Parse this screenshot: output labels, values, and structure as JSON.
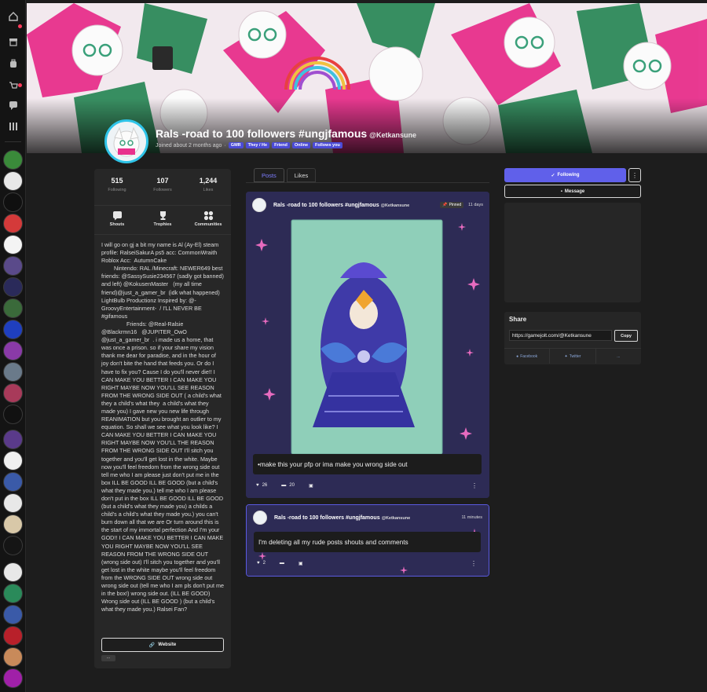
{
  "rail": {
    "nav_icons": [
      "home-icon",
      "store-icon",
      "backpack-icon",
      "cart-icon",
      "chat-icon",
      "library-icon"
    ]
  },
  "profile": {
    "display_name": "Rals -road to 100 followers #ungjfamous",
    "handle": "@Ketkansune",
    "joined": "Joined about 2 months ago",
    "tags": [
      "GMR",
      "They / He",
      "Friend",
      "Online",
      "Follows you"
    ]
  },
  "stats": [
    {
      "value": "515",
      "label": "Following"
    },
    {
      "value": "107",
      "label": "Followers"
    },
    {
      "value": "1,244",
      "label": "Likes"
    }
  ],
  "actions": [
    {
      "label": "Shouts",
      "icon": "chat-bubble-icon"
    },
    {
      "label": "Trophies",
      "icon": "trophy-icon"
    },
    {
      "label": "Communities",
      "icon": "grid-icon"
    }
  ],
  "bio": "I will go on gj a bit my name is Al (Ay-El) steam profile: RalseiSakurA ps5 acc: CommonWraith Roblox Acc:  AutumnCake\n        Nintendo: RAL /Minecraft: NEWER649 best friends: @SassySusie234567 (sadly got banned) and left) @KokusenMaster   (my all time friend)@just_a_gamer_br  (idk what happened) LightBulb Productionz Inspired by: @-GroovyEntertainment-  / I'LL NEVER BE #gifamous \n                Friends: @Real-Ralsie \n@Blackrmn16   @JUPITER_OwO \n@just_a_gamer_br  . i made us a home, that was once a prison. so if your share my vision thank me dear for paradise, and in the hour of joy don't bite the hand that feeds you. Or do I have to fix you? Cause I do you'll never die!! I CAN MAKE YOU BETTER I CAN MAKE YOU RIGHT MAYBE NOW YOU'LL SEE REASON FROM THE WRONG SIDE OUT ( a child's what they a child's what they  a child's what they made you) I gave new you new life through REANIMATION but you brought an outlier to my equation. So shall we see what you look like? I CAN MAKE YOU BETTER I CAN MAKE YOU RIGHT MAYBE NOW YOU'LL THE REASON FROM THE WRONG SIDE OUT I'll sitch you together and you'll get lost in the white. Maybe now you'll feel freedom from the wrong side out tell me who I am please just don't put me in the box ILL BE GOOD ILL BE GOOD (but a child's what they made you.) tell me who I am please don't put in the box ILL BE GOOD ILL BE GOOD (but a child's what they made you) a childs a child's a child's what they made you.) you can't burn down all that we are Or turn around this is the start of my immortal perfection And I'm your GOD!! I CAN MAKE YOU BETTER I CAN MAKE YOU RIGHT MAYBE NOW YOU'LL SEE REASON FROM THE WRONG SIDE OUT (wrong side out) I'll sitch you together and you'll get lost in the white maybe you'll feel freedom from the WRONG SIDE OUT wrong side out wrong side out (tell me who I am pls don't put me in the box!) wrong side out. (ILL BE GOOD) Wrong side out (ILL BE GOOD ) (but a child's what they made you.) Ralsei Fan?",
  "website_label": "Website",
  "more_label": "...",
  "tabs": [
    {
      "label": "Posts",
      "active": true
    },
    {
      "label": "Likes",
      "active": false
    }
  ],
  "posts": [
    {
      "author": "Rals -road to 100 followers #ungjfamous",
      "handle": "@Ketkansune",
      "pinned_label": "Pinned",
      "time": "11 days",
      "caption": "•make this your pfp or ima make you wrong side out",
      "likes": "26",
      "comments": "20"
    },
    {
      "author": "Rals -road to 100 followers #ungjfamous",
      "handle": "@Ketkansune",
      "time": "11 minutes",
      "caption": "I'm deleting all my rude posts shouts and comments",
      "likes": "2"
    }
  ],
  "sidebar": {
    "following_label": "Following",
    "message_label": "Message",
    "share_title": "Share",
    "share_url": "https://gamejolt.com/@Ketkansune",
    "copy_label": "Copy",
    "facebook_label": "Facebook",
    "twitter_label": "Twitter",
    "more_label": "..."
  },
  "colors": {
    "accent": "#6060ea",
    "avatar_ring": "#2fc4e8",
    "banner_pink": "#e8308c",
    "banner_green": "#2e8a5a"
  }
}
